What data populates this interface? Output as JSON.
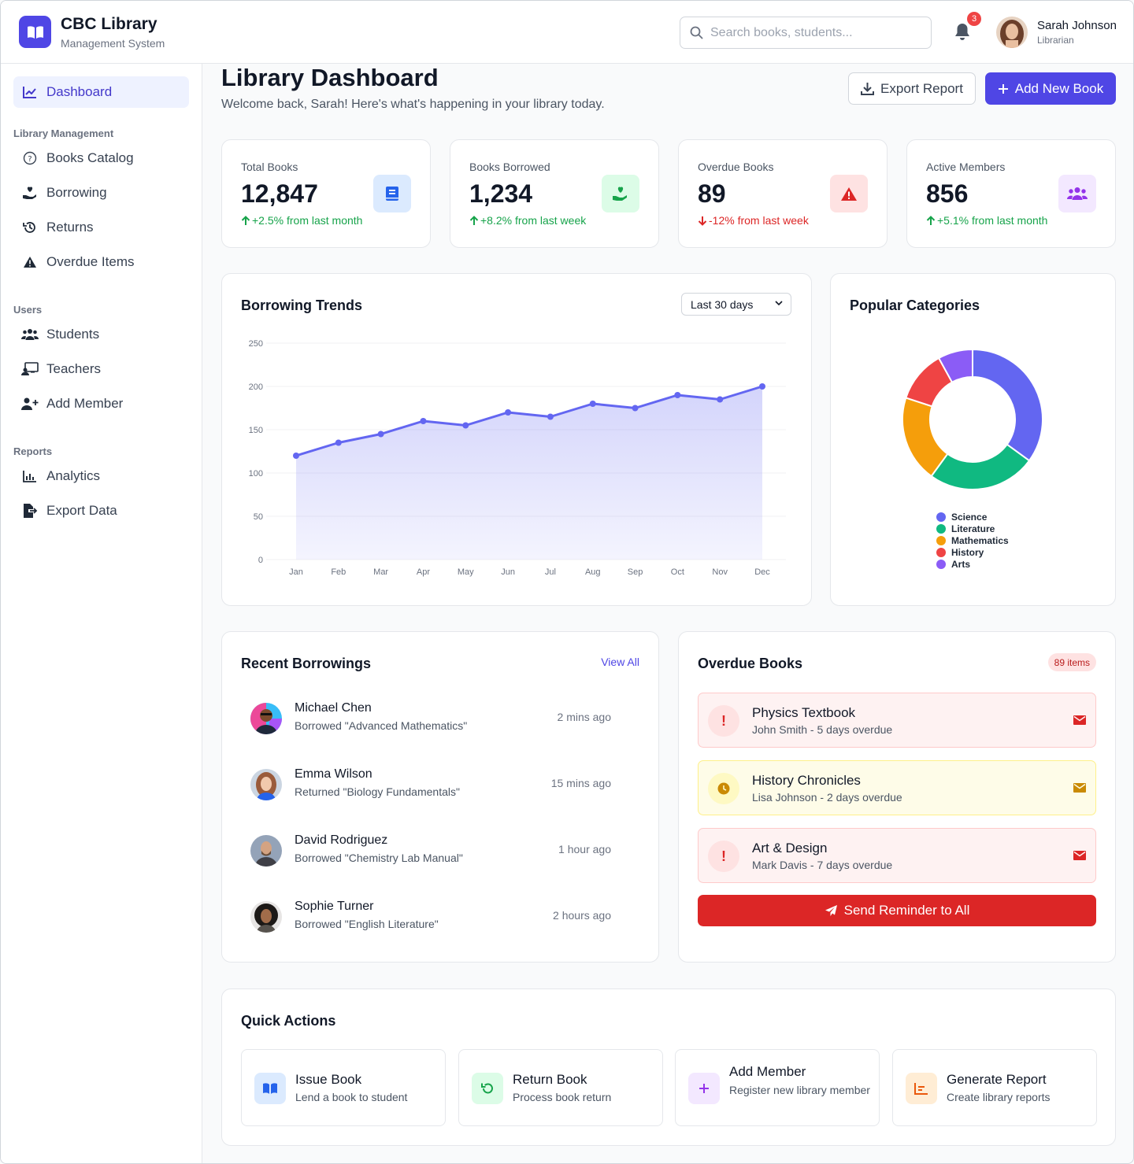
{
  "brand": {
    "title": "CBC Library",
    "subtitle": "Management System"
  },
  "search": {
    "placeholder": "Search books, students..."
  },
  "notifications": {
    "count": "3"
  },
  "user": {
    "name": "Sarah Johnson",
    "role": "Librarian"
  },
  "sidebar": {
    "dashboard": "Dashboard",
    "sections": [
      {
        "label": "Library Management",
        "items": [
          "Books Catalog",
          "Borrowing",
          "Returns",
          "Overdue Items"
        ]
      },
      {
        "label": "Users",
        "items": [
          "Students",
          "Teachers",
          "Add Member"
        ]
      },
      {
        "label": "Reports",
        "items": [
          "Analytics",
          "Export Data"
        ]
      }
    ]
  },
  "page": {
    "title": "Library Dashboard",
    "subtitle": "Welcome back, Sarah! Here's what's happening in your library today.",
    "export_label": "Export Report",
    "add_label": "Add New Book"
  },
  "stats": [
    {
      "label": "Total Books",
      "value": "12,847",
      "change": "+2.5% from last month",
      "trend": "up",
      "icon": "book-icon",
      "color": "#2563eb",
      "bg": "#dbeafe"
    },
    {
      "label": "Books Borrowed",
      "value": "1,234",
      "change": "+8.2% from last week",
      "trend": "up",
      "icon": "hand-heart-icon",
      "color": "#16a34a",
      "bg": "#dcfce7"
    },
    {
      "label": "Overdue Books",
      "value": "89",
      "change": "-12% from last week",
      "trend": "down",
      "icon": "warning-icon",
      "color": "#dc2626",
      "bg": "#fee2e2"
    },
    {
      "label": "Active Members",
      "value": "856",
      "change": "+5.1% from last month",
      "trend": "up",
      "icon": "users-icon",
      "color": "#9333ea",
      "bg": "#f3e8ff"
    }
  ],
  "trends": {
    "title": "Borrowing Trends",
    "range_selected": "Last 30 days"
  },
  "categories": {
    "title": "Popular Categories"
  },
  "chart_data": [
    {
      "type": "area",
      "title": "Borrowing Trends",
      "categories": [
        "Jan",
        "Feb",
        "Mar",
        "Apr",
        "May",
        "Jun",
        "Jul",
        "Aug",
        "Sep",
        "Oct",
        "Nov",
        "Dec"
      ],
      "values": [
        120,
        135,
        145,
        160,
        155,
        170,
        165,
        180,
        175,
        190,
        185,
        200
      ],
      "ylim": [
        0,
        250
      ],
      "yticks": [
        0,
        50,
        100,
        150,
        200,
        250
      ],
      "color": "#6366f1",
      "grid": true
    },
    {
      "type": "pie",
      "title": "Popular Categories",
      "donut": true,
      "labels": [
        "Science",
        "Literature",
        "Mathematics",
        "History",
        "Arts"
      ],
      "values": [
        35,
        25,
        20,
        12,
        8
      ],
      "colors": [
        "#6366f1",
        "#10b981",
        "#f59e0b",
        "#ef4444",
        "#8b5cf6"
      ],
      "legend": "bottom"
    }
  ],
  "recent": {
    "title": "Recent Borrowings",
    "view_all": "View All",
    "items": [
      {
        "name": "Michael Chen",
        "desc": "Borrowed \"Advanced Mathematics\"",
        "time": "2 mins ago"
      },
      {
        "name": "Emma Wilson",
        "desc": "Returned \"Biology Fundamentals\"",
        "time": "15 mins ago"
      },
      {
        "name": "David Rodriguez",
        "desc": "Borrowed \"Chemistry Lab Manual\"",
        "time": "1 hour ago"
      },
      {
        "name": "Sophie Turner",
        "desc": "Borrowed \"English Literature\"",
        "time": "2 hours ago"
      }
    ]
  },
  "overdue": {
    "title": "Overdue Books",
    "badge": "89 items",
    "items": [
      {
        "title": "Physics Textbook",
        "sub": "John Smith - 5 days overdue",
        "level": "red"
      },
      {
        "title": "History Chronicles",
        "sub": "Lisa Johnson - 2 days overdue",
        "level": "yellow"
      },
      {
        "title": "Art & Design",
        "sub": "Mark Davis - 7 days overdue",
        "level": "red"
      }
    ],
    "remind_label": "Send Reminder to All"
  },
  "quick": {
    "title": "Quick Actions",
    "items": [
      {
        "title": "Issue Book",
        "sub": "Lend a book to student"
      },
      {
        "title": "Return Book",
        "sub": "Process book return"
      },
      {
        "title": "Add Member",
        "sub": "Register new library member"
      },
      {
        "title": "Generate Report",
        "sub": "Create library reports"
      }
    ]
  }
}
